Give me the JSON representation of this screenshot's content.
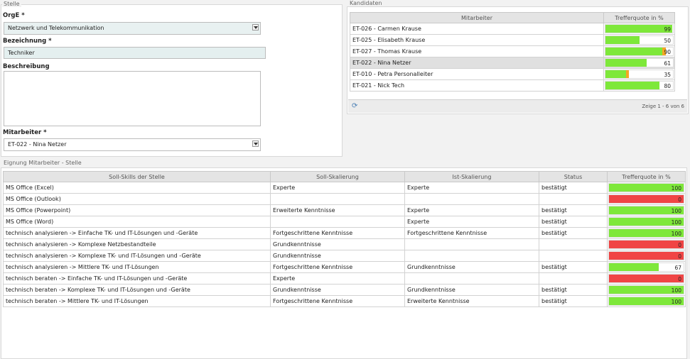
{
  "stelle": {
    "title": "Stelle",
    "orge_label": "OrgE *",
    "orge_value": "Netzwerk und Telekommunikation",
    "bezeichnung_label": "Bezeichnung *",
    "bezeichnung_value": "Techniker",
    "beschreibung_label": "Beschreibung",
    "beschreibung_value": "",
    "mitarbeiter_label": "Mitarbeiter *",
    "mitarbeiter_value": "ET-022 - Nina Netzer"
  },
  "kandidaten": {
    "title": "Kandidaten",
    "headers": [
      "Mitarbeiter",
      "Trefferquote in %"
    ],
    "rows": [
      {
        "name": "ET-026 - Carmen Krause",
        "green": 99,
        "orange": 0,
        "label": "99"
      },
      {
        "name": "ET-025 - Elisabeth Krause",
        "green": 50,
        "orange": 0,
        "label": "50"
      },
      {
        "name": "ET-027 - Thomas Krause",
        "green": 84,
        "orange": 6,
        "label": "90"
      },
      {
        "name": "ET-022 - Nina Netzer",
        "green": 61,
        "orange": 0,
        "label": "61"
      },
      {
        "name": "ET-010 - Petra Personalleiter",
        "green": 30,
        "orange": 5,
        "label": "35"
      },
      {
        "name": "ET-021 - Nick Tech",
        "green": 80,
        "orange": 0,
        "label": "80"
      }
    ],
    "selected_index": 3,
    "pager": "Zeige 1 - 6 von 6"
  },
  "eignung": {
    "title": "Eignung Mitarbeiter - Stelle",
    "headers": [
      "Soll-Skills der Stelle",
      "Soll-Skalierung",
      "Ist-Skalierung",
      "Status",
      "Trefferquote in %"
    ],
    "rows": [
      {
        "skill": "MS Office (Excel)",
        "soll": "Experte",
        "ist": "Experte",
        "status": "bestätigt",
        "quote": 100,
        "label": "100"
      },
      {
        "skill": "MS Office (Outlook)",
        "soll": "",
        "ist": "",
        "status": "",
        "quote": 0,
        "label": "0"
      },
      {
        "skill": "MS Office (Powerpoint)",
        "soll": "Erweiterte Kenntnisse",
        "ist": "Experte",
        "status": "bestätigt",
        "quote": 100,
        "label": "100"
      },
      {
        "skill": "MS Office (Word)",
        "soll": "",
        "ist": "Experte",
        "status": "bestätigt",
        "quote": 100,
        "label": "100"
      },
      {
        "skill": "technisch analysieren -> Einfache TK- und IT-Lösungen und -Geräte",
        "soll": "Fortgeschrittene Kenntnisse",
        "ist": "Fortgeschrittene Kenntnisse",
        "status": "bestätigt",
        "quote": 100,
        "label": "100"
      },
      {
        "skill": "technisch analysieren -> Komplexe Netzbestandteile",
        "soll": "Grundkenntnisse",
        "ist": "",
        "status": "",
        "quote": 0,
        "label": "0"
      },
      {
        "skill": "technisch analysieren -> Komplexe TK- und IT-Lösungen und -Geräte",
        "soll": "Grundkenntnisse",
        "ist": "",
        "status": "",
        "quote": 0,
        "label": "0"
      },
      {
        "skill": "technisch analysieren -> Mittlere TK- und IT-Lösungen",
        "soll": "Fortgeschrittene Kenntnisse",
        "ist": "Grundkenntnisse",
        "status": "bestätigt",
        "quote": 67,
        "label": "67"
      },
      {
        "skill": "technisch beraten -> Einfache TK- und IT-Lösungen und -Geräte",
        "soll": "Experte",
        "ist": "",
        "status": "",
        "quote": 0,
        "label": "0"
      },
      {
        "skill": "technisch beraten -> Komplexe TK- und IT-Lösungen und -Geräte",
        "soll": "Grundkenntnisse",
        "ist": "Grundkenntnisse",
        "status": "bestätigt",
        "quote": 100,
        "label": "100"
      },
      {
        "skill": "technisch beraten -> Mittlere TK- und IT-Lösungen",
        "soll": "Fortgeschrittene Kenntnisse",
        "ist": "Erweiterte Kenntnisse",
        "status": "bestätigt",
        "quote": 100,
        "label": "100"
      }
    ]
  },
  "colors": {
    "green": "#7ee83a",
    "orange": "#f5a623",
    "red": "#f04545"
  },
  "icons": {
    "refresh": "refresh-icon",
    "dropdown": "chevron-down-icon"
  }
}
